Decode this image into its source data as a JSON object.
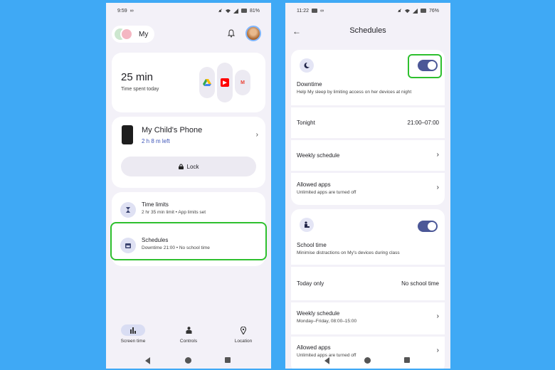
{
  "left": {
    "status": {
      "time": "9:59",
      "extra": "∞",
      "battery": "81%"
    },
    "header": {
      "profile_label": "My"
    },
    "screen_time": {
      "value": "25 min",
      "caption": "Time spent today"
    },
    "device": {
      "name": "My Child's Phone",
      "time_left": "2 h 8 m left",
      "lock_label": "Lock"
    },
    "list": [
      {
        "title": "Time limits",
        "sub": "2 hr 35 min limit • App limits set"
      },
      {
        "title": "Schedules",
        "sub": "Downtime 21:00 • No school time"
      }
    ],
    "nav": [
      {
        "label": "Screen time",
        "icon": "bar-chart-icon"
      },
      {
        "label": "Controls",
        "icon": "person-icon"
      },
      {
        "label": "Location",
        "icon": "location-pin-icon"
      }
    ]
  },
  "right": {
    "status": {
      "time": "11:22",
      "extra": "∞",
      "battery": "76%"
    },
    "title": "Schedules",
    "downtime": {
      "title": "Downtime",
      "desc": "Help My sleep by limiting access on her devices at night",
      "tonight_label": "Tonight",
      "tonight_value": "21:00–07:00",
      "weekly_label": "Weekly schedule",
      "allowed_label": "Allowed apps",
      "allowed_sub": "Unlimited apps are turned off"
    },
    "school": {
      "title": "School time",
      "desc": "Minimise distractions on My's devices during class",
      "today_label": "Today only",
      "today_value": "No school time",
      "weekly_label": "Weekly schedule",
      "weekly_sub": "Monday–Friday, 08:00–15:00",
      "allowed_label": "Allowed apps",
      "allowed_sub": "Unlimited apps are turned off"
    }
  },
  "colors": {
    "background": "#3fa9f5",
    "highlight": "#2ec02e",
    "toggle": "#4b5797",
    "accent_text": "#3c54b8"
  }
}
